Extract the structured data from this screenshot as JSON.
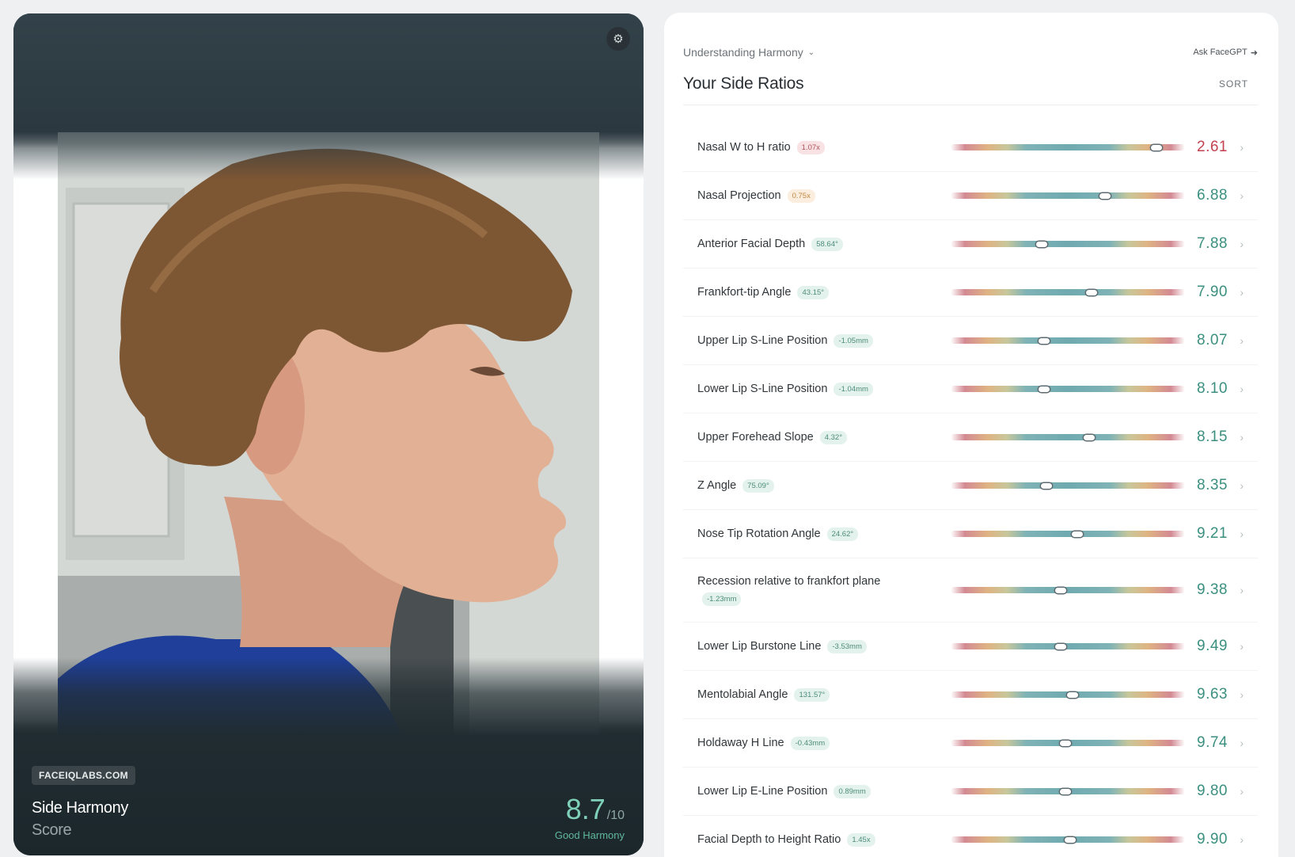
{
  "photo_card": {
    "brand": "FACEIQLABS.COM",
    "title": "Side Harmony",
    "subtitle": "Score",
    "score": "8.7",
    "score_denominator": "/10",
    "score_label": "Good Harmony",
    "settings_icon": "gear-icon"
  },
  "panel": {
    "dropdown_label": "Understanding Harmony",
    "ask_label": "Ask FaceGPT",
    "title": "Your Side Ratios",
    "sort_label": "SORT"
  },
  "colors": {
    "good_score": "#3a8f7f",
    "bad_score": "#c2414f",
    "accent": "#7fd0b8"
  },
  "ratios": [
    {
      "name": "Nasal W to H ratio",
      "badge": "1.07x",
      "score": "2.61",
      "position": 0.88,
      "status": "bad"
    },
    {
      "name": "Nasal Projection",
      "badge": "0.75x",
      "score": "6.88",
      "position": 0.66,
      "status": "warn"
    },
    {
      "name": "Anterior Facial Depth",
      "badge": "58.64°",
      "score": "7.88",
      "position": 0.39,
      "status": "good"
    },
    {
      "name": "Frankfort-tip Angle",
      "badge": "43.15°",
      "score": "7.90",
      "position": 0.6,
      "status": "good"
    },
    {
      "name": "Upper Lip S-Line Position",
      "badge": "-1.05mm",
      "score": "8.07",
      "position": 0.4,
      "status": "good"
    },
    {
      "name": "Lower Lip S-Line Position",
      "badge": "-1.04mm",
      "score": "8.10",
      "position": 0.4,
      "status": "good"
    },
    {
      "name": "Upper Forehead Slope",
      "badge": "4.32°",
      "score": "8.15",
      "position": 0.59,
      "status": "good"
    },
    {
      "name": "Z Angle",
      "badge": "75.09°",
      "score": "8.35",
      "position": 0.41,
      "status": "good"
    },
    {
      "name": "Nose Tip Rotation Angle",
      "badge": "24.62°",
      "score": "9.21",
      "position": 0.54,
      "status": "good"
    },
    {
      "name": "Recession relative to frankfort plane",
      "badge": "-1.23mm",
      "score": "9.38",
      "position": 0.47,
      "status": "good"
    },
    {
      "name": "Lower Lip Burstone Line",
      "badge": "-3.53mm",
      "score": "9.49",
      "position": 0.47,
      "status": "good"
    },
    {
      "name": "Mentolabial Angle",
      "badge": "131.57°",
      "score": "9.63",
      "position": 0.52,
      "status": "good"
    },
    {
      "name": "Holdaway H Line",
      "badge": "-0.43mm",
      "score": "9.74",
      "position": 0.49,
      "status": "good"
    },
    {
      "name": "Lower Lip E-Line Position",
      "badge": "0.89mm",
      "score": "9.80",
      "position": 0.49,
      "status": "good"
    },
    {
      "name": "Facial Depth to Height Ratio",
      "badge": "1.45x",
      "score": "9.90",
      "position": 0.51,
      "status": "good"
    }
  ]
}
